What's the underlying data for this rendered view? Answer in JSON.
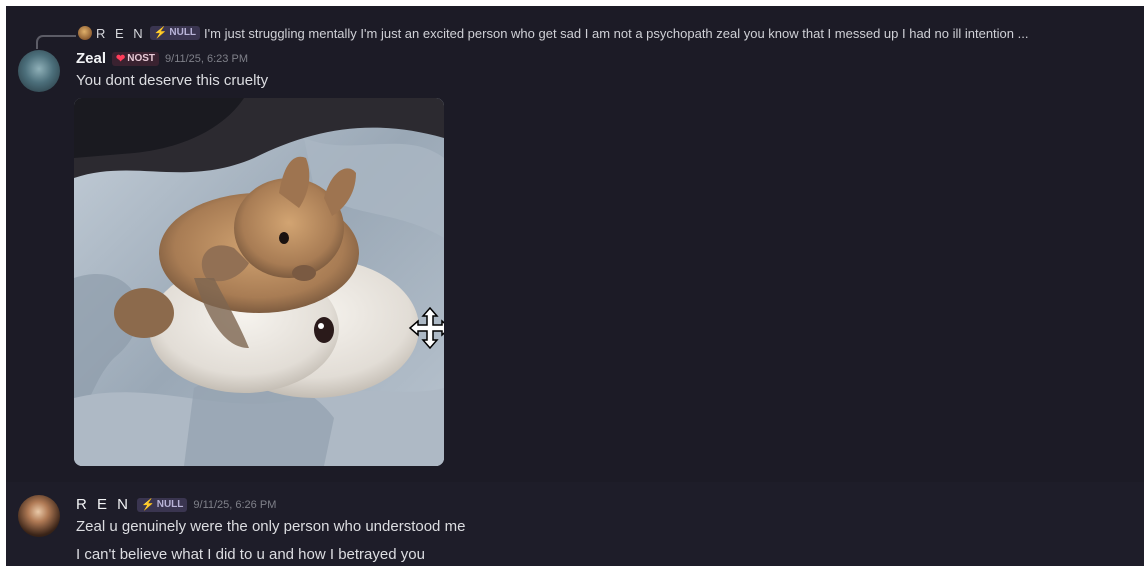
{
  "reply": {
    "author": "R E N",
    "author_tag": "NULL",
    "text": "I'm just struggling mentally I'm just an excited person who get sad I am not a psychopath zeal you know that I messed up I had no ill intention ..."
  },
  "messages": [
    {
      "author": "Zeal",
      "tag": "NOST",
      "timestamp": "9/11/25, 6:23 PM",
      "lines": [
        "You dont deserve this cruelty"
      ],
      "has_image": true
    },
    {
      "author": "R E N",
      "tag": "NULL",
      "timestamp": "9/11/25, 6:26 PM",
      "lines": [
        "Zeal u genuinely were the only person who understood me",
        "I can't believe what I did to u and how I betrayed you"
      ]
    }
  ],
  "icons": {
    "bolt": "⚡",
    "heart": "❤",
    "move_cursor": "move-cursor-icon"
  },
  "colors": {
    "background": "#1c1b26",
    "text": "#dcdde1",
    "timestamp": "#7f8089",
    "null_tag_bg": "#3a3550",
    "nost_tag_bg": "#3a2230"
  }
}
